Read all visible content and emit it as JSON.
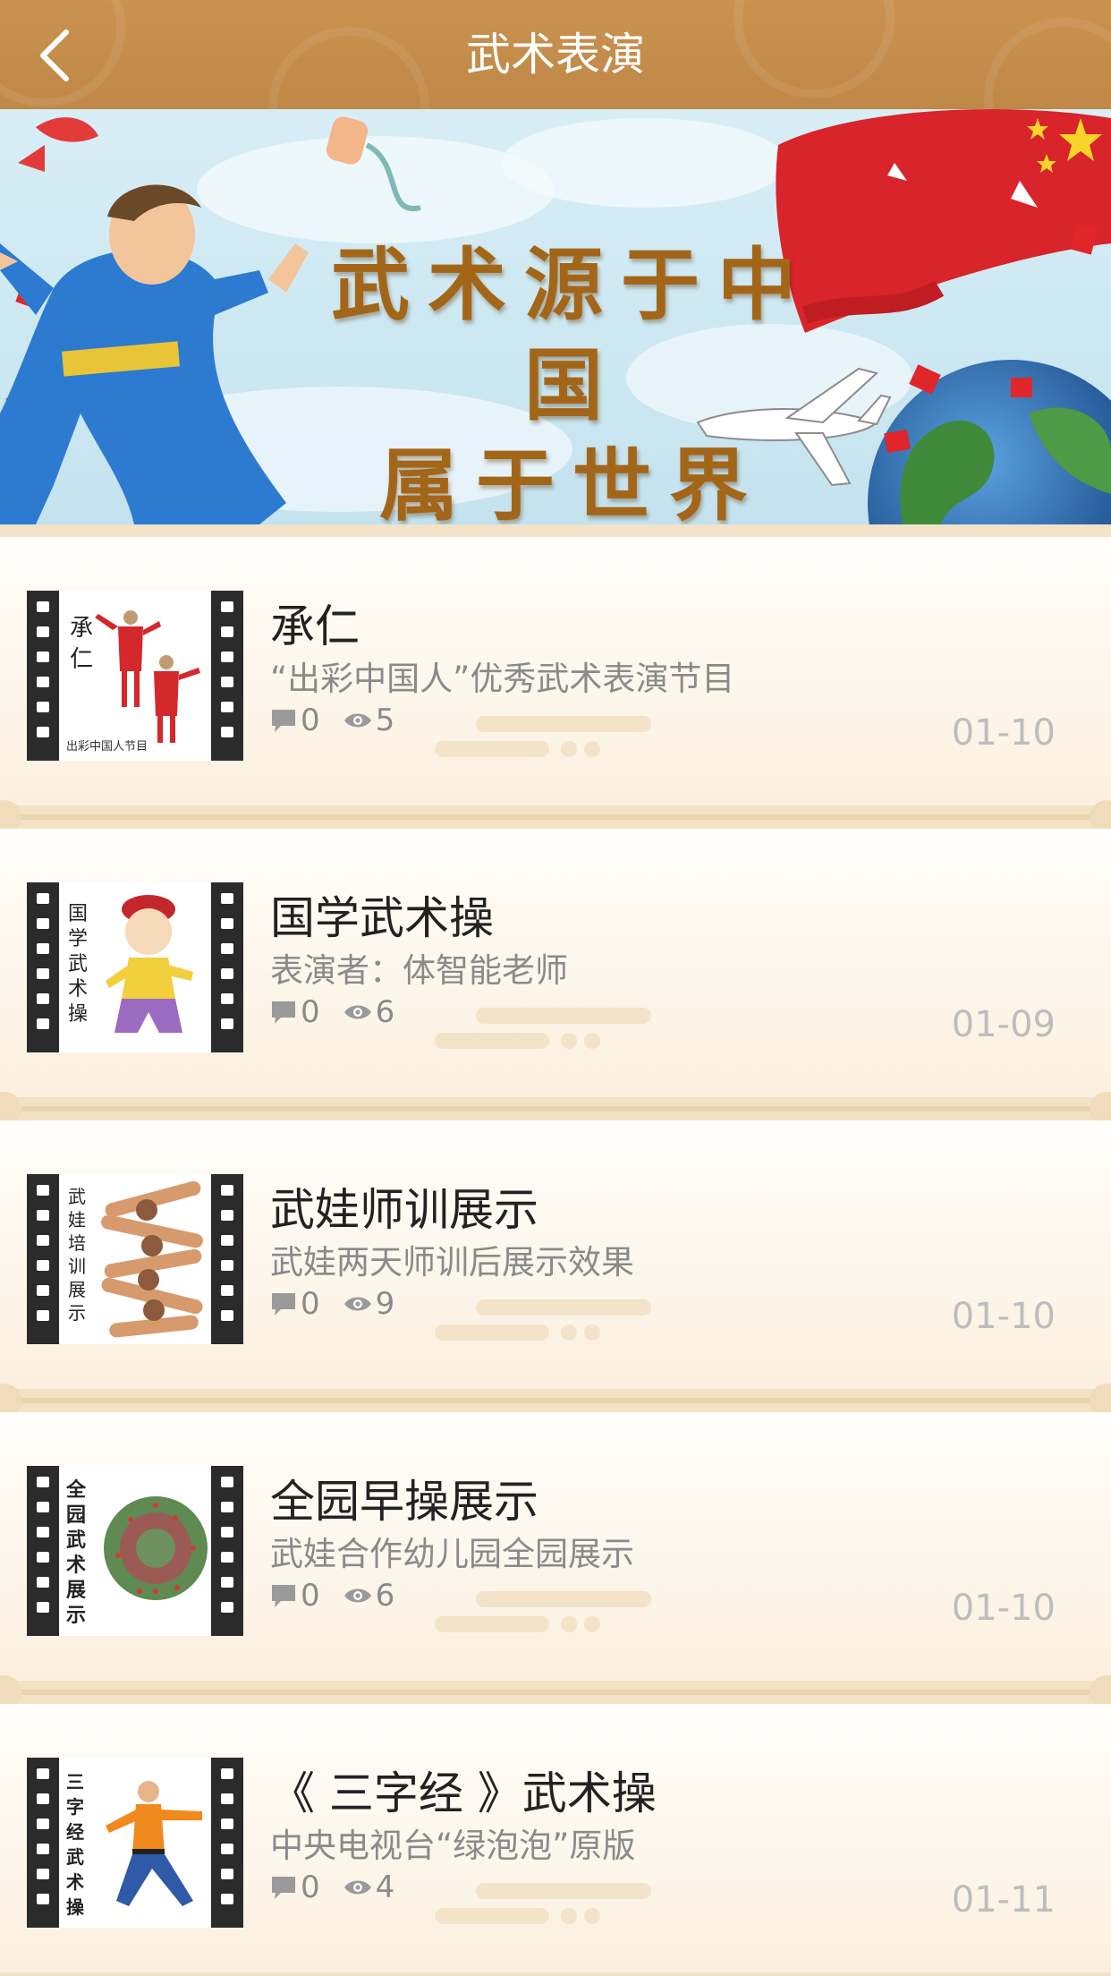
{
  "header": {
    "title": "武术表演",
    "back_icon": "chevron-left-icon"
  },
  "banner": {
    "text_line1": "武术源于中国",
    "text_line2": "属于世界"
  },
  "items": [
    {
      "title": "承仁",
      "subtitle": "“出彩中国人”优秀武术表演节目",
      "comments": "0",
      "views": "5",
      "date": "01-10",
      "thumb_text": "承仁",
      "thumb_caption": "出彩中国人节目"
    },
    {
      "title": "国学武术操",
      "subtitle": "表演者：体智能老师",
      "comments": "0",
      "views": "6",
      "date": "01-09",
      "thumb_text": "国学武术操"
    },
    {
      "title": "武娃师训展示",
      "subtitle": "武娃两天师训后展示效果",
      "comments": "0",
      "views": "9",
      "date": "01-10",
      "thumb_text": "武娃培训展示"
    },
    {
      "title": "全园早操展示",
      "subtitle": "武娃合作幼儿园全园展示",
      "comments": "0",
      "views": "6",
      "date": "01-10",
      "thumb_text": "全园武术展示"
    },
    {
      "title": "《 三字经 》武术操",
      "subtitle": "中央电视台“绿泡泡”原版",
      "comments": "0",
      "views": "4",
      "date": "01-11",
      "thumb_text": "三字经武术操"
    }
  ],
  "icons": {
    "comment": "comment-icon",
    "views": "eye-icon"
  }
}
